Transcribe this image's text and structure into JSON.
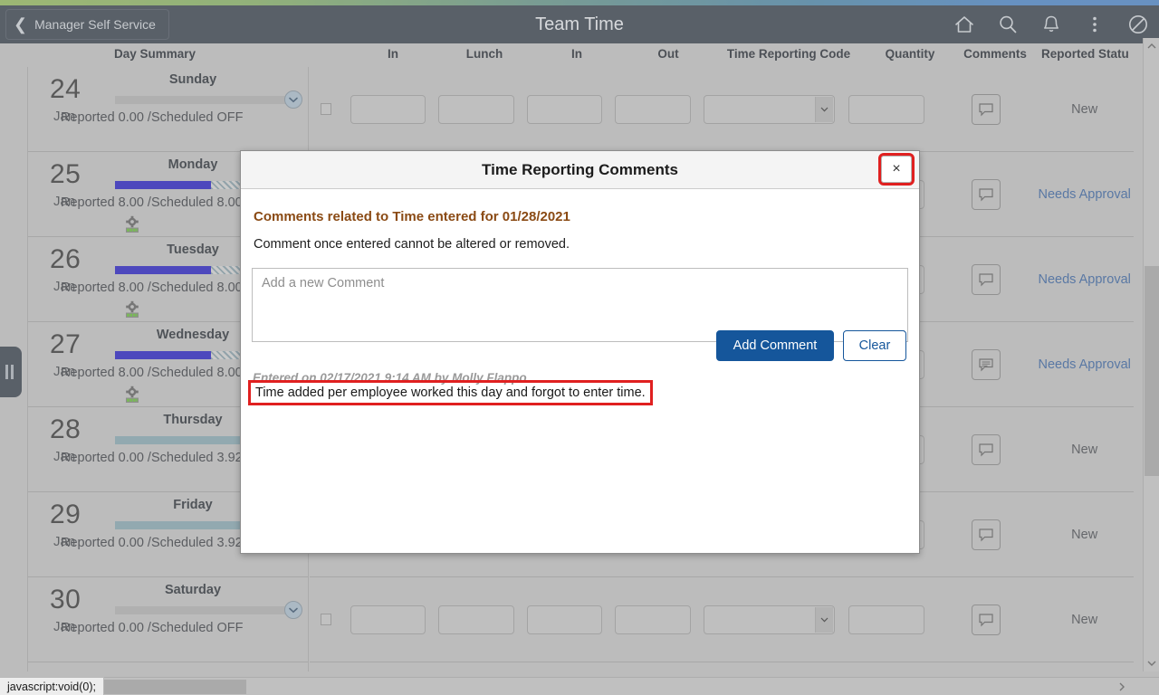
{
  "header": {
    "back_label": "Manager Self Service",
    "title": "Team Time",
    "icons": [
      {
        "name": "home-icon",
        "label": "Home"
      },
      {
        "name": "search-icon",
        "label": "Search"
      },
      {
        "name": "notifications-bell-icon",
        "label": "Notifications"
      },
      {
        "name": "actions-menu-icon",
        "label": "Actions"
      },
      {
        "name": "nav-bar-compass-icon",
        "label": "NavBar"
      }
    ]
  },
  "grid": {
    "columns": [
      "Day Summary",
      "In",
      "Lunch",
      "In",
      "Out",
      "Time Reporting Code",
      "Quantity",
      "Comments",
      "Reported Statu"
    ],
    "rows": [
      {
        "day_num": "24",
        "month": "Jan",
        "day_name": "Sunday",
        "reported": "Reported 0.00 /Scheduled OFF",
        "bar_fill_pct": 100,
        "bar_style": "grey",
        "bar_hatch_pct": 0,
        "has_gear": false,
        "has_chevron": true,
        "status": "New",
        "status_kind": "new",
        "comment_icon": "comment-empty-icon"
      },
      {
        "day_num": "25",
        "month": "Jan",
        "day_name": "Monday",
        "reported": "Reported 8.00 /Scheduled 8.00",
        "bar_fill_pct": 52,
        "bar_style": "blue",
        "bar_hatch_pct": 48,
        "has_gear": true,
        "has_chevron": false,
        "status": "Needs Approval",
        "status_kind": "link",
        "comment_icon": "comment-empty-icon"
      },
      {
        "day_num": "26",
        "month": "Jan",
        "day_name": "Tuesday",
        "reported": "Reported 8.00 /Scheduled 8.00",
        "bar_fill_pct": 52,
        "bar_style": "blue",
        "bar_hatch_pct": 48,
        "has_gear": true,
        "has_chevron": false,
        "status": "Needs Approval",
        "status_kind": "link",
        "comment_icon": "comment-empty-icon"
      },
      {
        "day_num": "27",
        "month": "Jan",
        "day_name": "Wednesday",
        "reported": "Reported 8.00 /Scheduled 8.00",
        "bar_fill_pct": 52,
        "bar_style": "blue",
        "bar_hatch_pct": 48,
        "has_gear": true,
        "has_chevron": false,
        "status": "Needs Approval",
        "status_kind": "link",
        "comment_icon": "comment-filled-icon"
      },
      {
        "day_num": "28",
        "month": "Jan",
        "day_name": "Thursday",
        "reported": "Reported 0.00 /Scheduled 3.92",
        "bar_fill_pct": 100,
        "bar_style": "teal",
        "bar_hatch_pct": 0,
        "has_gear": false,
        "has_chevron": false,
        "status": "New",
        "status_kind": "new",
        "comment_icon": "comment-empty-icon"
      },
      {
        "day_num": "29",
        "month": "Jan",
        "day_name": "Friday",
        "reported": "Reported 0.00 /Scheduled 3.92",
        "bar_fill_pct": 100,
        "bar_style": "teal",
        "bar_hatch_pct": 0,
        "has_gear": false,
        "has_chevron": true,
        "status": "New",
        "status_kind": "new",
        "comment_icon": "comment-empty-icon"
      },
      {
        "day_num": "30",
        "month": "Jan",
        "day_name": "Saturday",
        "reported": "Reported 0.00 /Scheduled OFF",
        "bar_fill_pct": 100,
        "bar_style": "grey",
        "bar_hatch_pct": 0,
        "has_gear": false,
        "has_chevron": true,
        "status": "New",
        "status_kind": "new",
        "comment_icon": "comment-empty-icon"
      }
    ]
  },
  "modal": {
    "title": "Time Reporting Comments",
    "close_label": "×",
    "heading": "Comments related to Time entered for 01/28/2021",
    "subtext": "Comment once entered cannot be altered or removed.",
    "textarea_placeholder": "Add a new Comment",
    "textarea_value": "",
    "add_button": "Add Comment",
    "clear_button": "Clear",
    "entered_line": "Entered on 02/17/2021 9:14 AM by Molly Flappo",
    "previous_comment": "Time added per employee worked this day and forgot to enter time."
  },
  "statusbar": {
    "text": "javascript:void(0);"
  },
  "colors": {
    "header_bg": "#4a525c",
    "page_bg": "#c3c3c3",
    "accent_blue": "#15569b",
    "link_blue": "#4a6fa5",
    "heading_brown": "#8a4a14",
    "highlight_red": "#e02020",
    "progress_blue": "#3b35c4",
    "progress_teal": "#8fabb4"
  }
}
